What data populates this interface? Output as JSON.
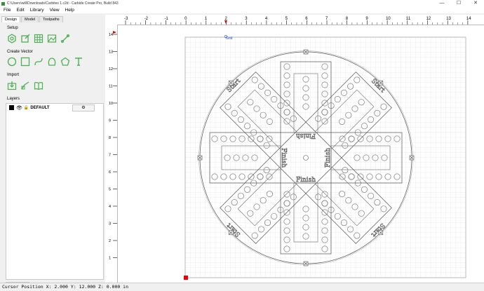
{
  "window": {
    "title": "C:\\Users\\will\\Downloads\\Carbites 1.c2d - Carbide Create Pro, Build 843",
    "minimize": "—",
    "maximize": "☐",
    "close": "✕"
  },
  "menu": [
    "File",
    "Edit",
    "Library",
    "View",
    "Help"
  ],
  "tabs": [
    "Design",
    "Model",
    "Toolpaths"
  ],
  "sections": {
    "setup": "Setup",
    "create_vector": "Create Vector",
    "import": "Import",
    "layers": "Layers"
  },
  "setup_tools": [
    "job-setup-icon",
    "edit-icon",
    "grid-icon",
    "image-icon",
    "pen-icon"
  ],
  "vector_tools": [
    "circle-icon",
    "rectangle-icon",
    "curve-icon",
    "polyline-icon",
    "polygon-icon",
    "text-icon"
  ],
  "import_tools": [
    "import-icon",
    "trace-icon",
    "book-icon"
  ],
  "layer": {
    "name": "DEFAULT",
    "color": "#000000",
    "gear": "⚙"
  },
  "add_layer_label": "+",
  "ruler": {
    "top_labels": [
      "-3",
      "-2",
      "-1",
      "0",
      "1",
      "2",
      "3",
      "4",
      "5",
      "6",
      "7",
      "8",
      "9",
      "10",
      "11",
      "12",
      "13",
      "14"
    ],
    "left_labels": [
      "1",
      "2",
      "3",
      "4",
      "5",
      "6",
      "7",
      "8",
      "9",
      "10",
      "11",
      "12",
      "13",
      "14"
    ]
  },
  "canvas": {
    "grid_label": "Grid",
    "text_finish": "Finish",
    "text_start": "Start",
    "accent": "#4caf50"
  },
  "status": "Cursor Position X: 2.000 Y: 12.000 Z: 0.000 in"
}
